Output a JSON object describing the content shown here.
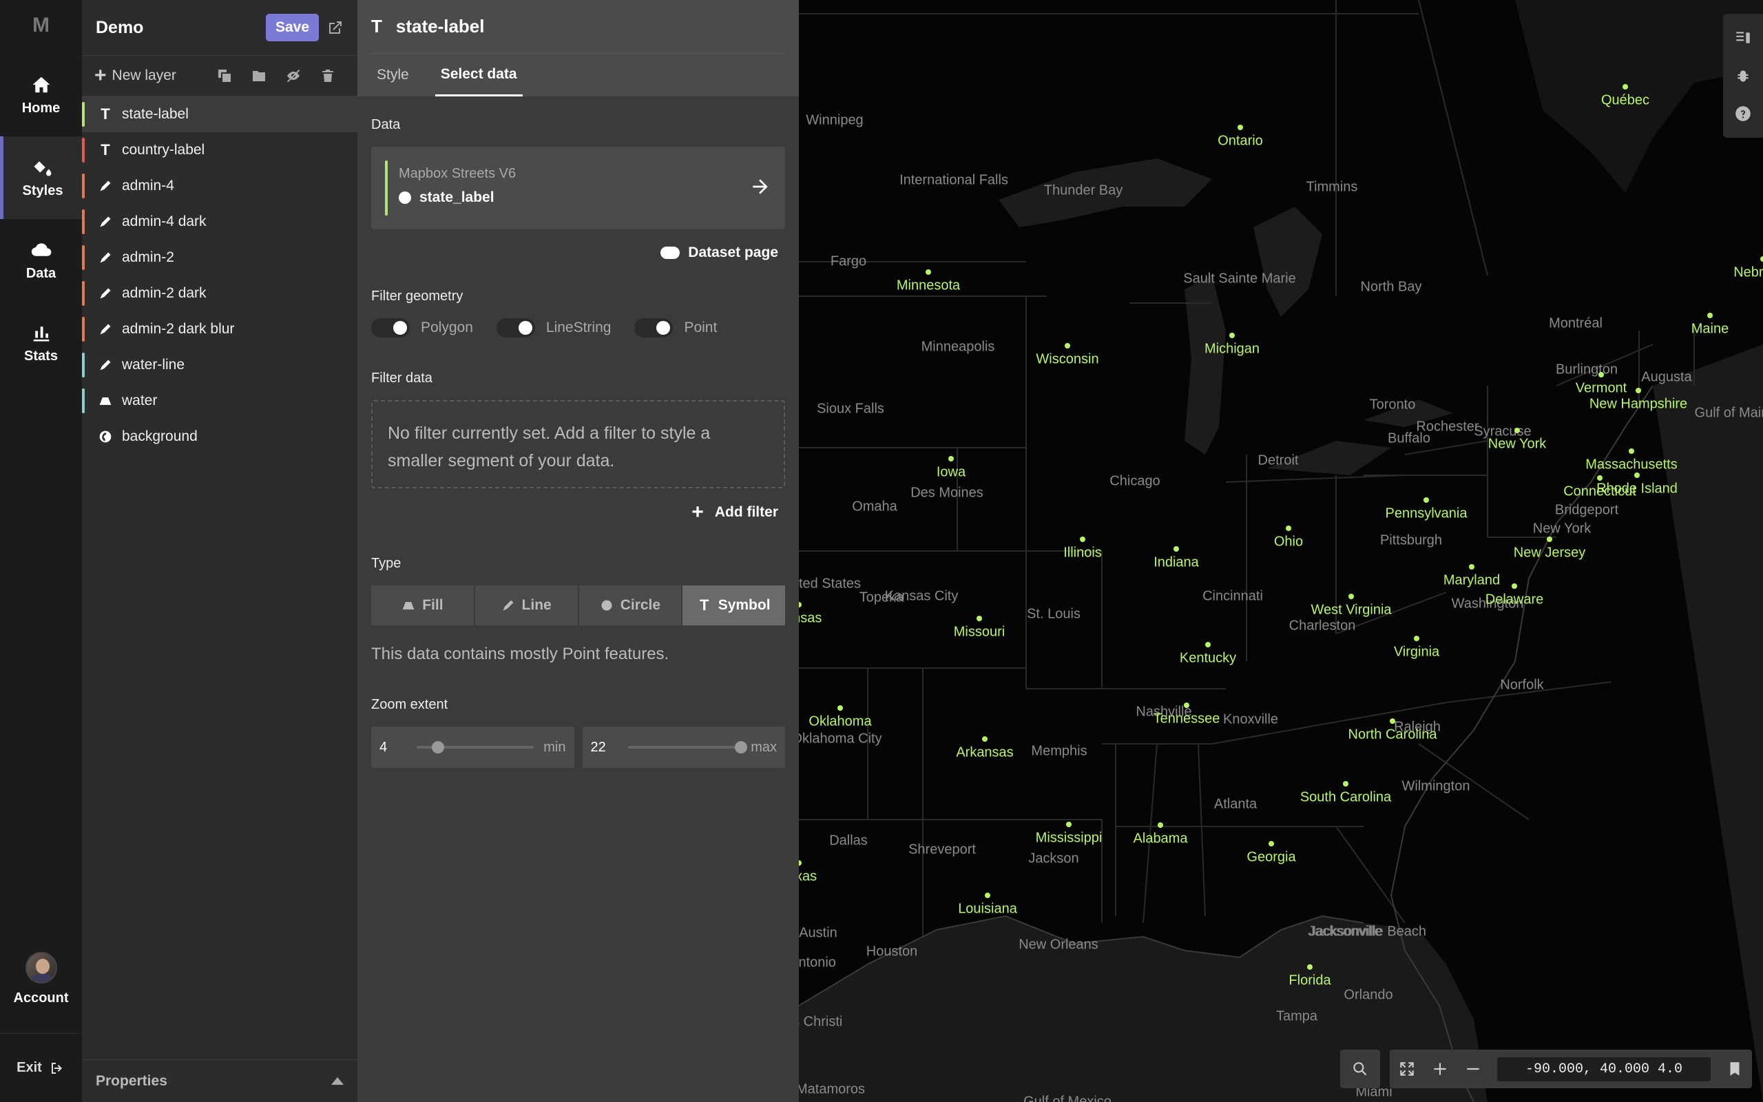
{
  "nav": {
    "logo": "M",
    "items": [
      {
        "label": "Home",
        "icon": "home-icon"
      },
      {
        "label": "Styles",
        "icon": "paint-bucket-icon"
      },
      {
        "label": "Data",
        "icon": "cloud-icon"
      },
      {
        "label": "Stats",
        "icon": "bar-chart-icon"
      }
    ],
    "account": "Account",
    "exit": "Exit"
  },
  "layers_panel": {
    "title": "Demo",
    "save": "Save",
    "new_layer": "New layer",
    "layers": [
      {
        "name": "state-label",
        "type": "symbol",
        "color": "#b6e27c",
        "active": true
      },
      {
        "name": "country-label",
        "type": "symbol",
        "color": "#e05a5a"
      },
      {
        "name": "admin-4",
        "type": "line",
        "color": "#e07a5a"
      },
      {
        "name": "admin-4 dark",
        "type": "line",
        "color": "#e07a5a"
      },
      {
        "name": "admin-2",
        "type": "line",
        "color": "#e07a5a"
      },
      {
        "name": "admin-2 dark",
        "type": "line",
        "color": "#e07a5a"
      },
      {
        "name": "admin-2 dark blur",
        "type": "line",
        "color": "#e07a5a"
      },
      {
        "name": "water-line",
        "type": "line",
        "color": "#8ed0c8"
      },
      {
        "name": "water",
        "type": "fill",
        "color": "#8ed0c8"
      },
      {
        "name": "background",
        "type": "background",
        "color": ""
      }
    ],
    "properties": "Properties"
  },
  "editor": {
    "layer_name": "state-label",
    "tabs": [
      "Style",
      "Select data"
    ],
    "active_tab": "Select data",
    "data_label": "Data",
    "source_name": "Mapbox Streets V6",
    "source_layer": "state_label",
    "dataset_page": "Dataset page",
    "filter_geometry_label": "Filter geometry",
    "geometry_toggles": [
      "Polygon",
      "LineString",
      "Point"
    ],
    "filter_data_label": "Filter data",
    "filter_placeholder": "No filter currently set. Add a filter to style a smaller segment of your data.",
    "add_filter": "Add filter",
    "type_label": "Type",
    "types": [
      "Fill",
      "Line",
      "Circle",
      "Symbol"
    ],
    "active_type": "Symbol",
    "type_note": "This data contains mostly Point features.",
    "zoom_label": "Zoom extent",
    "zoom_min": {
      "value": "4",
      "unit": "min"
    },
    "zoom_max": {
      "value": "22",
      "unit": "max"
    },
    "zoom_range_fraction": {
      "min": 0.18,
      "max": 1.0
    }
  },
  "map": {
    "coordinates": "-90.000, 40.000 4.0",
    "cities": [
      "Winnipeg",
      "International Falls",
      "Thunder Bay",
      "Timmins",
      "Fargo",
      "Sault Sainte Marie",
      "North Bay",
      "Minneapolis",
      "Montréal",
      "Burlington",
      "Augusta",
      "Sioux Falls",
      "Toronto",
      "Rochester",
      "Syracuse",
      "Buffalo",
      "Detroit",
      "Chicago",
      "Des Moines",
      "Omaha",
      "Pittsburgh",
      "New York",
      "Bridgeport",
      "United States",
      "Topeka",
      "Kansas City",
      "Cincinnati",
      "St. Louis",
      "Washington",
      "Charleston",
      "Norfolk",
      "Oklahoma City",
      "Nashville",
      "Knoxville",
      "Raleigh",
      "Memphis",
      "Wilmington",
      "Atlanta",
      "Dallas",
      "Shreveport",
      "Jackson",
      "Austin",
      "Houston",
      "New Orleans",
      "Jacksonville",
      "Jacksonville Beach",
      "Orlando",
      "Tampa",
      "San Antonio",
      "Corpus Christi",
      "Matamoros",
      "Miami",
      "Gulf of Mexico",
      "Gulf of Maine"
    ],
    "states": [
      "Québec",
      "Ontario",
      "Minnesota",
      "Wisconsin",
      "Michigan",
      "Maine",
      "Vermont",
      "New Hampshire",
      "New York",
      "Massachusetts",
      "Connecticut",
      "Rhode Island",
      "Iowa",
      "Pennsylvania",
      "Illinois",
      "Indiana",
      "Ohio",
      "New Jersey",
      "Maryland",
      "Delaware",
      "West Virginia",
      "Missouri",
      "Virginia",
      "Kentucky",
      "Kansas",
      "Oklahoma",
      "Tennessee",
      "North Carolina",
      "Arkansas",
      "South Carolina",
      "Mississippi",
      "Alabama",
      "Georgia",
      "Louisiana",
      "Florida",
      "Texas",
      "Nebraska"
    ]
  }
}
